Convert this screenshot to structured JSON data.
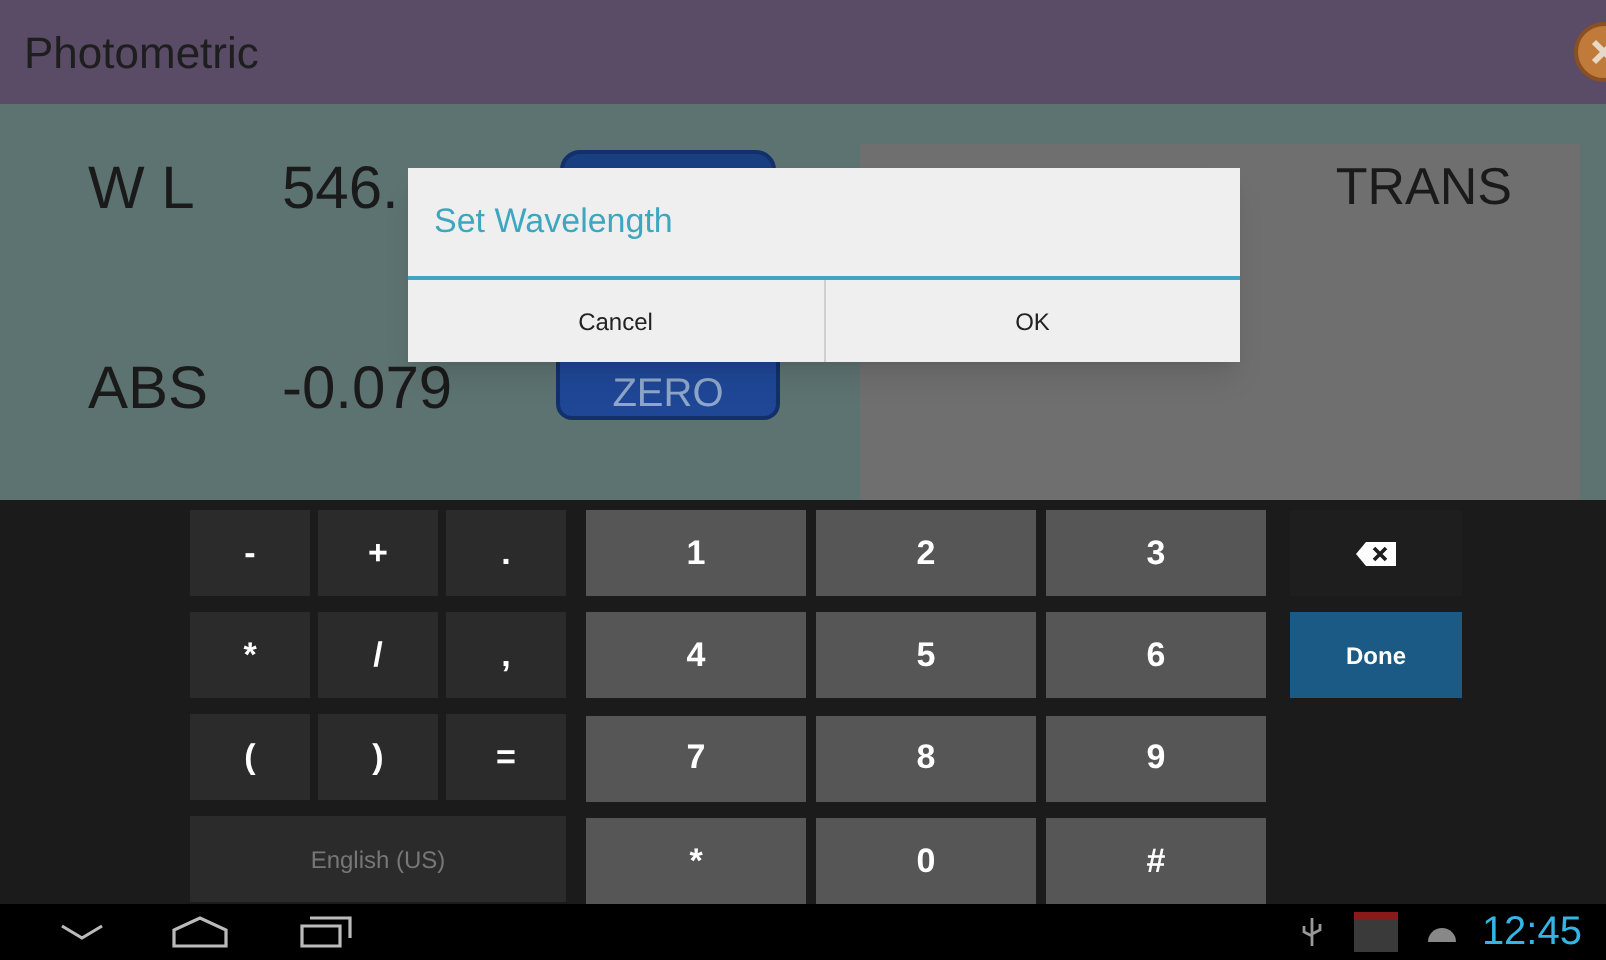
{
  "window": {
    "title": "Photometric"
  },
  "readings": [
    {
      "label": "W L",
      "value": "546."
    },
    {
      "label": "ABS",
      "value": "-0.079"
    }
  ],
  "zero_button": {
    "label": "ZERO"
  },
  "mode": "TRANS",
  "dialog": {
    "title": "Set Wavelength",
    "buttons": [
      "Cancel",
      "OK"
    ]
  },
  "keyboard": {
    "symbol_keys": [
      "-",
      "+",
      ".",
      "*",
      "/",
      ",",
      "(",
      ")",
      "="
    ],
    "language_key": "English (US)",
    "number_keys": [
      "1",
      "2",
      "3",
      "4",
      "5",
      "6",
      "7",
      "8",
      "9",
      "*",
      "0",
      "#"
    ],
    "done_key": "Done"
  },
  "status_bar": {
    "time": "12:45"
  }
}
